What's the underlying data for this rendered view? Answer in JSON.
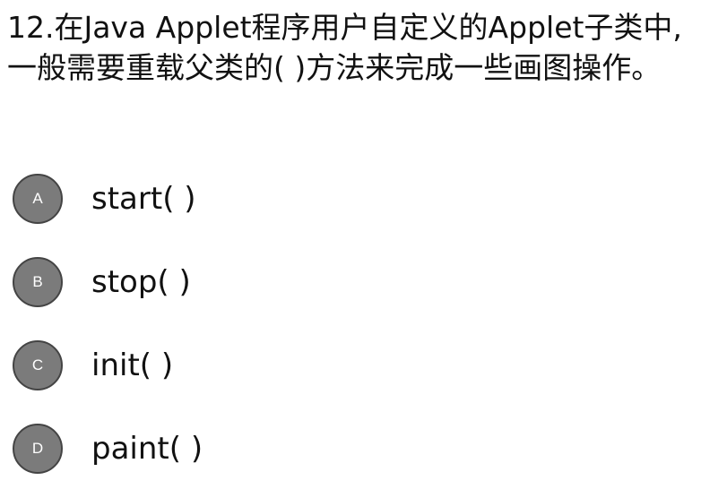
{
  "question": {
    "text": "12.在Java Applet程序用户自定义的Applet子类中,一般需要重载父类的(   )方法来完成一些画图操作。"
  },
  "options": [
    {
      "letter": "A",
      "text": "start( )"
    },
    {
      "letter": "B",
      "text": "stop( )"
    },
    {
      "letter": "C",
      "text": "init( )"
    },
    {
      "letter": "D",
      "text": "paint( )"
    }
  ],
  "colors": {
    "badge_fill": "#7b7b7b",
    "badge_border": "#444444",
    "text": "#111111",
    "background": "#ffffff"
  }
}
